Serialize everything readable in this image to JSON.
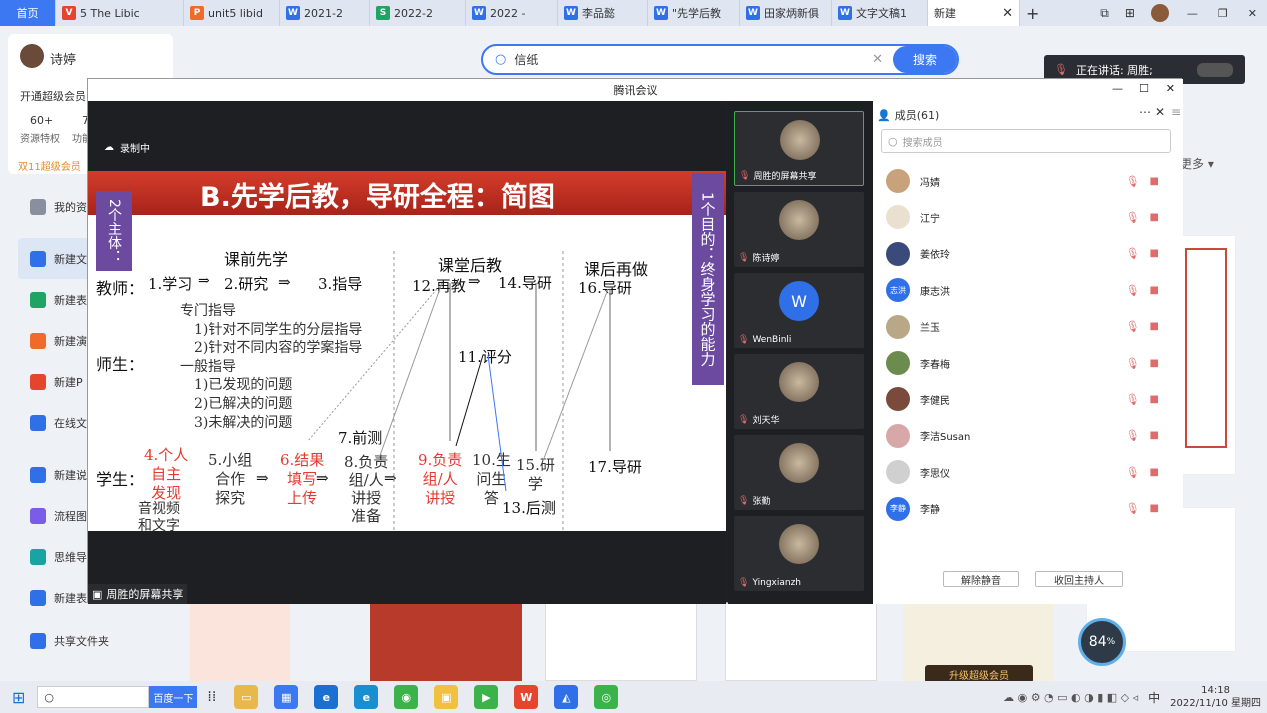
{
  "tabs": [
    {
      "label": "首页",
      "icon": "home"
    },
    {
      "label": "5 The Libic",
      "icon": "v-doc"
    },
    {
      "label": "unit5 libid",
      "icon": "p-doc"
    },
    {
      "label": "2021-2",
      "icon": "w-doc"
    },
    {
      "label": "2022-2",
      "icon": "s-doc"
    },
    {
      "label": "2022 -",
      "icon": "w-doc"
    },
    {
      "label": "李品懿",
      "icon": "w-doc"
    },
    {
      "label": "\"先学后教",
      "icon": "w-doc"
    },
    {
      "label": "田家炳新俱",
      "icon": "w-doc"
    },
    {
      "label": "文字文稿1",
      "icon": "w-doc"
    },
    {
      "label": "新建",
      "icon": "none"
    }
  ],
  "browser": {
    "user_name": "诗婷",
    "vip_text": "开通超级会员",
    "stat1_value": "60+",
    "stat1_label": "资源特权",
    "stat2_value": "7",
    "stat2_label": "功能",
    "promo": "双11超级会员",
    "more": "更多",
    "search_value": "信纸",
    "search_button": "搜索",
    "upgrade": "升级超级会员",
    "speed": "84",
    "speed_unit": "%"
  },
  "sidebar": [
    {
      "label": "我的资",
      "color": "#8a8fa0"
    },
    {
      "label": "新建文",
      "color": "#2f6fe8"
    },
    {
      "label": "新建表",
      "color": "#1fa464"
    },
    {
      "label": "新建演",
      "color": "#f06b2a"
    },
    {
      "label": "新建P",
      "color": "#e5452f"
    },
    {
      "label": "在线文",
      "color": "#2f6fe8"
    },
    {
      "label": "新建说",
      "color": "#2f6fe8"
    },
    {
      "label": "流程图",
      "color": "#7b5ce8"
    },
    {
      "label": "思维导",
      "color": "#19a3a3"
    },
    {
      "label": "新建表",
      "color": "#2f6fe8"
    },
    {
      "label": "共享文件夹",
      "color": "#2f6fe8"
    }
  ],
  "speaker": {
    "label": "正在讲话: 周胜;"
  },
  "meeting": {
    "title": "腾讯会议",
    "recording": "录制中",
    "share_label": "周胜的屏幕共享"
  },
  "slide": {
    "title": "B.先学后教，导研全程：简图",
    "left_banner": "2个主体：",
    "right_banner": "1个目的：终身学习的能力",
    "h_pre": "课前先学",
    "h_class": "课堂后教",
    "h_post": "课后再做",
    "row_teacher": "教师：",
    "row_ts": "师生：",
    "row_student": "学生：",
    "t1": "1.学习",
    "t2": "2.研究",
    "t3": "3.指导",
    "t12": "12.再教",
    "t14": "14.导研",
    "t16": "16.导研",
    "guide_lines": [
      "专门指导",
      "1)针对不同学生的分层指导",
      "2)针对不同内容的学案指导",
      "一般指导",
      "1)已发现的问题",
      "2)已解决的问题",
      "3)未解决的问题"
    ],
    "t11": "11.评分",
    "t7": "7.前测",
    "s4": [
      "4.个人",
      "自主",
      "发现"
    ],
    "s4b": [
      "音视频",
      "和文字"
    ],
    "s5": [
      "5.小组",
      "合作",
      "探究"
    ],
    "s6": [
      "6.结果",
      "填写",
      "上传"
    ],
    "s8": [
      "8.负责",
      "组/人",
      "讲授",
      "准备"
    ],
    "s9": [
      "9.负责",
      "组/人",
      "讲授"
    ],
    "s10": [
      "10.生",
      "问生",
      "答"
    ],
    "s15": [
      "15.研",
      "学"
    ],
    "s13": "13.后测",
    "s17": "17.导研"
  },
  "videos": [
    {
      "name": "周胜的屏幕共享",
      "avatar": "photo"
    },
    {
      "name": "陈诗婷",
      "avatar": "photo"
    },
    {
      "name": "WenBinli",
      "avatar": "W"
    },
    {
      "name": "刘天华",
      "avatar": "photo"
    },
    {
      "name": "张勤",
      "avatar": "photo"
    },
    {
      "name": "Yingxianzh",
      "avatar": "photo"
    }
  ],
  "members": {
    "title": "成员(61)",
    "search_placeholder": "搜索成员",
    "list": [
      {
        "name": "冯婧",
        "avatar": "",
        "color": "#c8a27a"
      },
      {
        "name": "江宁",
        "avatar": "",
        "color": "#e9e0d0"
      },
      {
        "name": "姜依玲",
        "avatar": "",
        "color": "#3a4a7a"
      },
      {
        "name": "康志洪",
        "avatar": "志洪",
        "color": "#2f6fe8"
      },
      {
        "name": "兰玉",
        "avatar": "",
        "color": "#b9a888"
      },
      {
        "name": "李春梅",
        "avatar": "",
        "color": "#6b8b4f"
      },
      {
        "name": "李健民",
        "avatar": "",
        "color": "#7a4a3a"
      },
      {
        "name": "李洁Susan",
        "avatar": "",
        "color": "#d8a8a8"
      },
      {
        "name": "李思仪",
        "avatar": "",
        "color": "#d0d0d0"
      },
      {
        "name": "李静",
        "avatar": "李静",
        "color": "#2f6fe8"
      }
    ],
    "unmute_btn": "解除静音",
    "reclaim_btn": "收回主持人"
  },
  "taskbar": {
    "search_btn": "百度一下",
    "time": "14:18",
    "date": "2022/11/10 星期四",
    "ime": "中"
  }
}
